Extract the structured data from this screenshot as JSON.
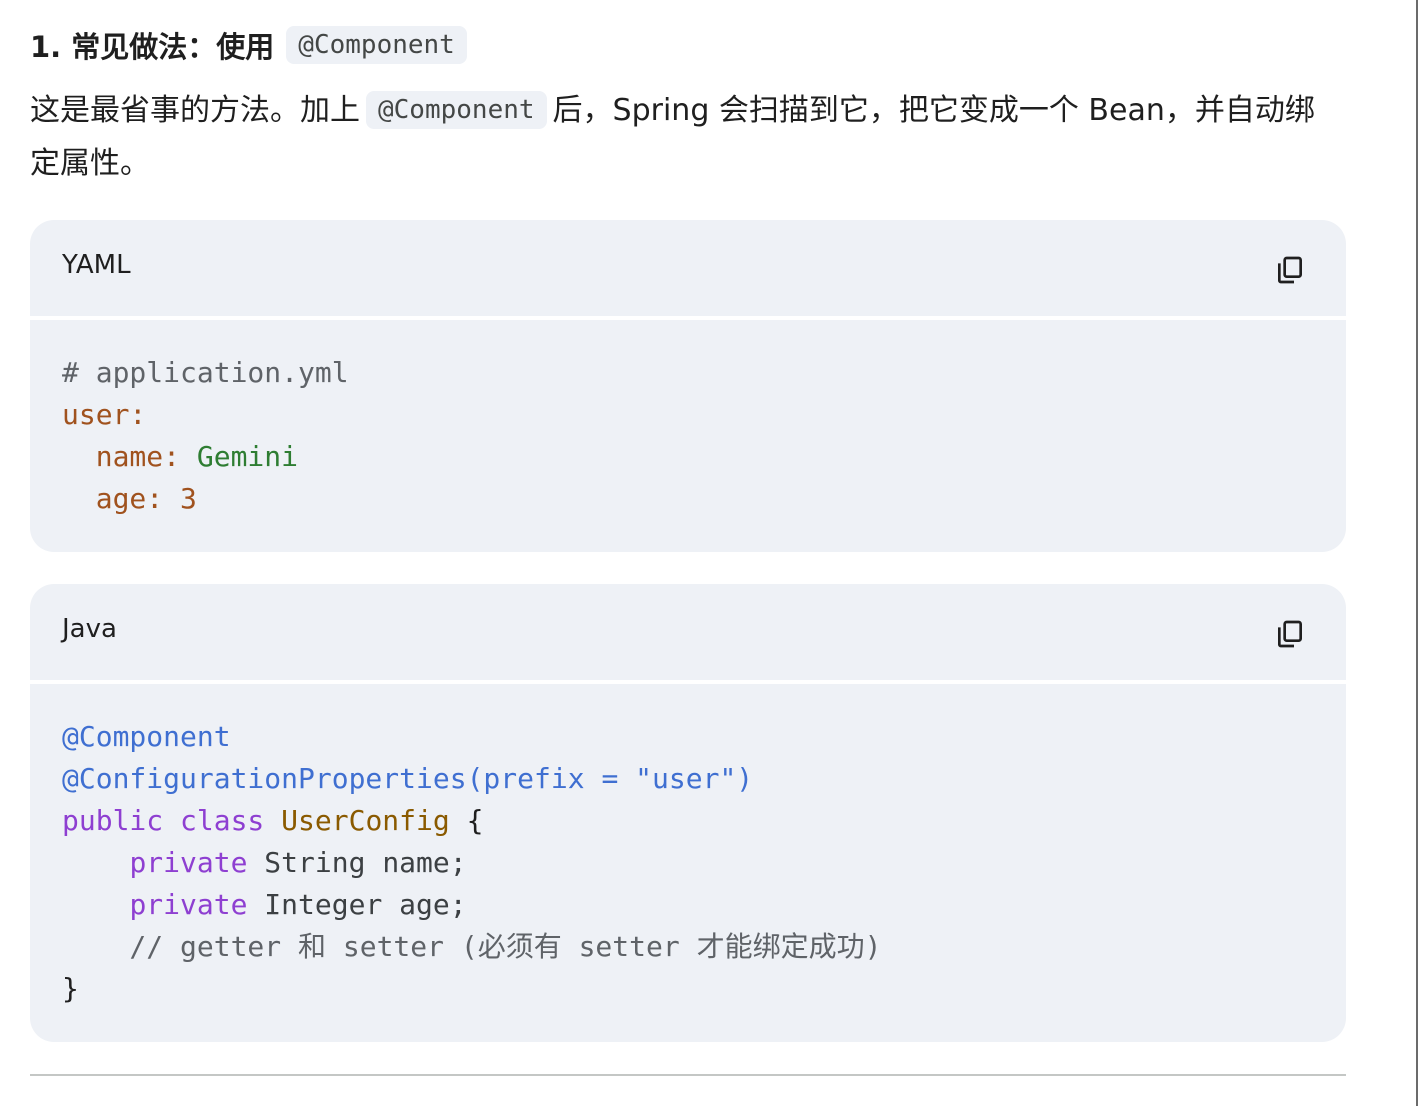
{
  "heading": {
    "text": "1. 常见做法：使用",
    "code": "@Component"
  },
  "paragraph": {
    "before": "这是最省事的方法。加上",
    "code": "@Component",
    "after": "后，Spring 会扫描到它，把它变成一个 Bean，并自动绑定属性。"
  },
  "yaml_block": {
    "language": "YAML",
    "copy_icon": "copy-icon",
    "lines": [
      [
        {
          "t": "# application.yml",
          "k": "comment"
        }
      ],
      [
        {
          "t": "user:",
          "k": "key"
        }
      ],
      [
        {
          "t": "  name: ",
          "k": "key"
        },
        {
          "t": "Gemini",
          "k": "str"
        }
      ],
      [
        {
          "t": "  age: 3",
          "k": "key"
        }
      ]
    ]
  },
  "java_block": {
    "language": "Java",
    "copy_icon": "copy-icon",
    "lines": [
      [
        {
          "t": "@Component",
          "k": "anno"
        }
      ],
      [
        {
          "t": "@ConfigurationProperties(prefix = \"user\")",
          "k": "anno"
        }
      ],
      [
        {
          "t": "public class ",
          "k": "kw"
        },
        {
          "t": "UserConfig",
          "k": "type"
        },
        {
          "t": " {",
          "k": "plain"
        }
      ],
      [
        {
          "t": "    ",
          "k": "plain"
        },
        {
          "t": "private",
          "k": "kw"
        },
        {
          "t": " String name;",
          "k": "dark"
        }
      ],
      [
        {
          "t": "    ",
          "k": "plain"
        },
        {
          "t": "private",
          "k": "kw"
        },
        {
          "t": " Integer age;",
          "k": "dark"
        }
      ],
      [
        {
          "t": "    // getter 和 setter (必须有 setter 才能绑定成功)",
          "k": "comment"
        }
      ],
      [
        {
          "t": "}",
          "k": "plain"
        }
      ]
    ]
  },
  "colors": {
    "code_background": "#eef1f6",
    "annotation": "#3f6fd1",
    "keyword": "#8e3fd1",
    "yaml_key": "#a0521e",
    "string": "#2e7d32"
  }
}
